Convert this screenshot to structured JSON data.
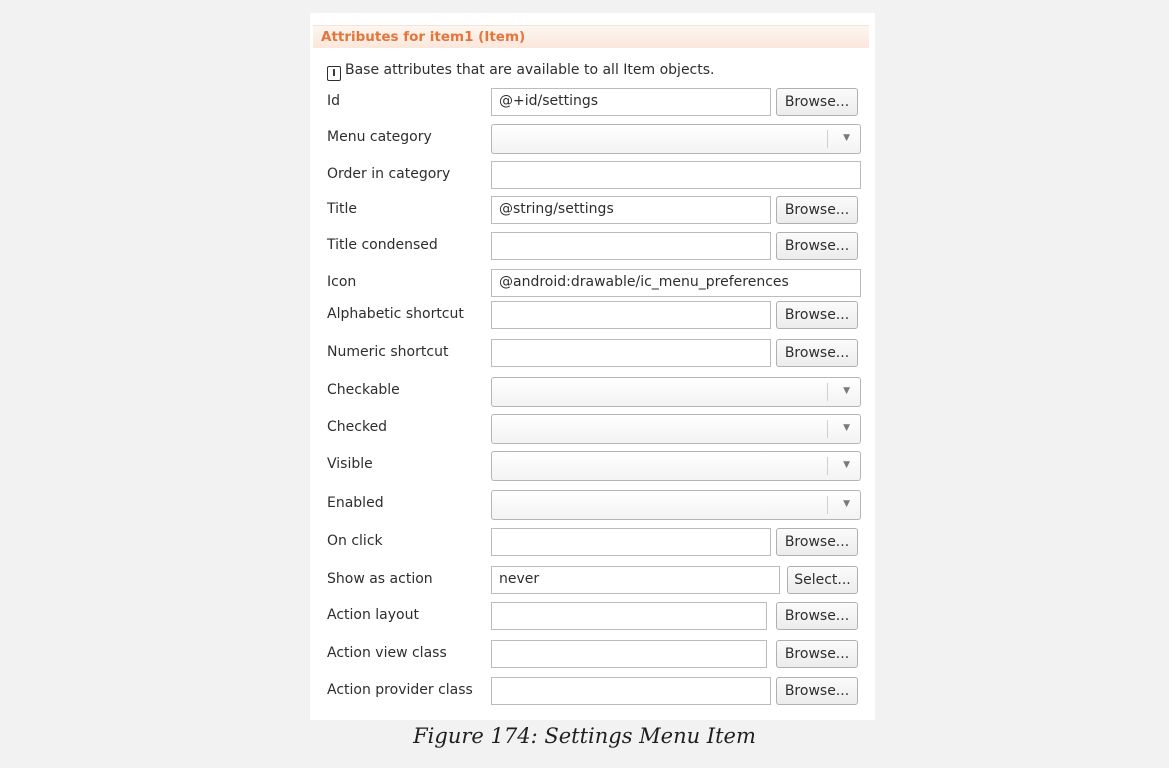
{
  "section": {
    "title": "Attributes for item1 (Item)",
    "info_icon": "I",
    "info_text": "Base attributes that are available to all Item objects."
  },
  "rows": [
    {
      "label": "Id",
      "kind": "text+button",
      "value": "@+id/settings",
      "button": "Browse..."
    },
    {
      "label": "Menu category",
      "kind": "combo",
      "value": ""
    },
    {
      "label": "Order in category",
      "kind": "text",
      "value": ""
    },
    {
      "label": "Title",
      "kind": "text+button",
      "value": "@string/settings",
      "button": "Browse..."
    },
    {
      "label": "Title condensed",
      "kind": "text+button",
      "value": "",
      "button": "Browse..."
    },
    {
      "label": "Icon",
      "kind": "text",
      "value": "@android:drawable/ic_menu_preferences"
    },
    {
      "label": "Alphabetic shortcut",
      "kind": "text+button",
      "value": "",
      "button": "Browse..."
    },
    {
      "label": "Numeric shortcut",
      "kind": "text+button",
      "value": "",
      "button": "Browse..."
    },
    {
      "label": "Checkable",
      "kind": "combo",
      "value": ""
    },
    {
      "label": "Checked",
      "kind": "combo",
      "value": ""
    },
    {
      "label": "Visible",
      "kind": "combo",
      "value": ""
    },
    {
      "label": "Enabled",
      "kind": "combo",
      "value": ""
    },
    {
      "label": "On click",
      "kind": "text+button",
      "value": "",
      "button": "Browse..."
    },
    {
      "label": "Show as action",
      "kind": "text+select",
      "value": "never",
      "button": "Select..."
    },
    {
      "label": "Action layout",
      "kind": "text+button",
      "value": "",
      "button": "Browse..."
    },
    {
      "label": "Action view class",
      "kind": "text+button",
      "value": "",
      "button": "Browse..."
    },
    {
      "label": "Action provider class",
      "kind": "text+button",
      "value": "",
      "button": "Browse..."
    }
  ],
  "caption": "Figure 174: Settings Menu Item",
  "colors": {
    "header_text": "#e2763b",
    "header_bg": "#fbe7dc"
  }
}
